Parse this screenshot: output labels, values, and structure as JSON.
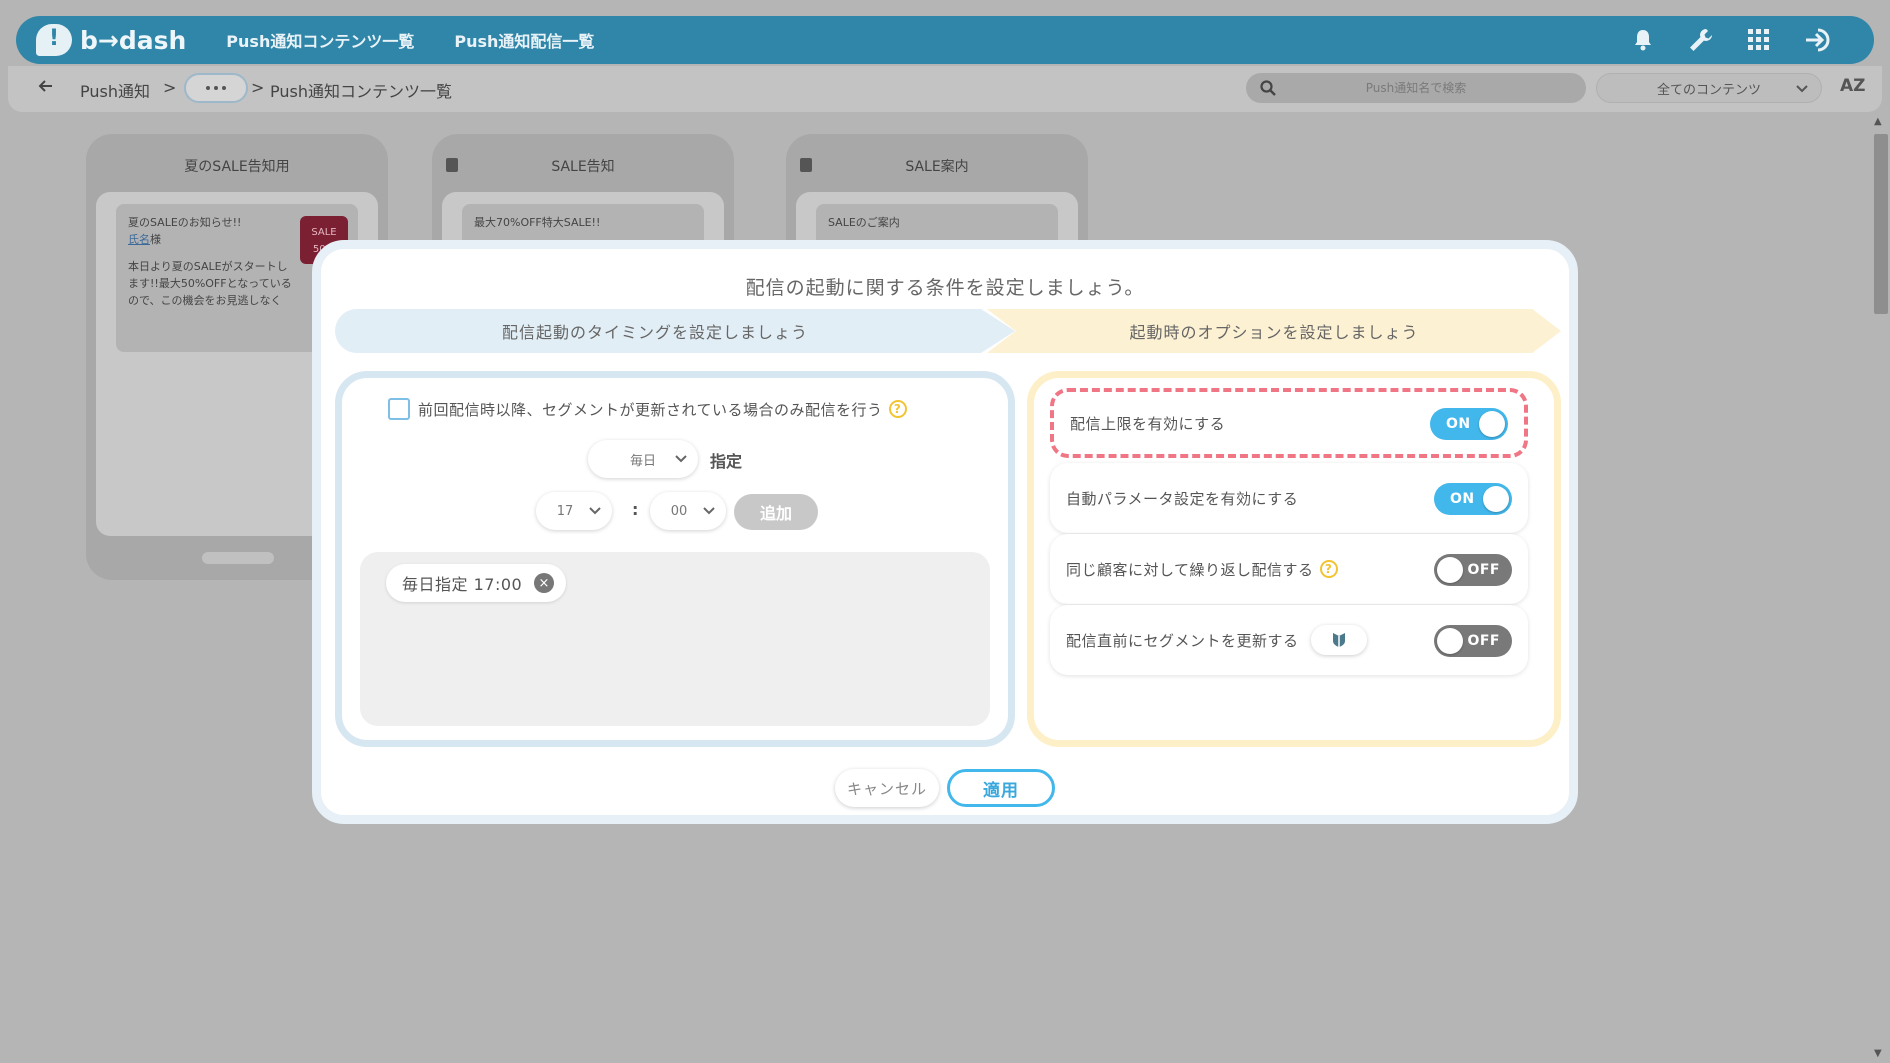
{
  "header": {
    "logo_text": "b→dash",
    "nav": [
      "Push通知コンテンツ一覧",
      "Push通知配信一覧"
    ],
    "icons": [
      "bell-icon",
      "wrench-icon",
      "grid-icon",
      "logout-icon"
    ]
  },
  "breadcrumb": {
    "root": "Push通知",
    "sep1": ">",
    "sep2": ">",
    "current": "Push通知コンテンツ一覧"
  },
  "search": {
    "placeholder": "Push通知名で検索"
  },
  "filter": {
    "selected": "全てのコンテンツ"
  },
  "sort": {
    "label": "AZ"
  },
  "cards": [
    {
      "title": "夏のSALE告知用",
      "msg_title": "夏のSALEのお知らせ!!",
      "name_link": "氏名",
      "name_suffix": "様",
      "body": "本日より夏のSALEがスタートします!!最大50%OFFとなっているので、この機会をお見逃しなく",
      "thumb": "SALE 50%"
    },
    {
      "title": "SALE告知",
      "msg_title": "最大70%OFF特大SALE!!"
    },
    {
      "title": "SALE案内",
      "msg_title": "SALEのご案内"
    }
  ],
  "modal": {
    "title": "配信の起動に関する条件を設定しましょう。",
    "step1": "配信起動のタイミングを設定しましょう",
    "step2": "起動時のオプションを設定しましょう",
    "left": {
      "checkbox_label": "前回配信時以降、セグメントが更新されている場合のみ配信を行う",
      "help": "?",
      "frequency": "毎日",
      "shitei": "指定",
      "hour": "17",
      "colon": ":",
      "minute": "00",
      "add_label": "追加",
      "chip": "毎日指定 17:00",
      "chip_remove": "×"
    },
    "options": [
      {
        "label": "配信上限を有効にする",
        "state": "ON"
      },
      {
        "label": "自動パラメータ設定を有効にする",
        "state": "ON"
      },
      {
        "label": "同じ顧客に対して繰り返し配信する",
        "state": "OFF",
        "help": "?"
      },
      {
        "label": "配信直前にセグメントを更新する",
        "state": "OFF"
      }
    ],
    "cancel_label": "キャンセル",
    "apply_label": "適用"
  },
  "colors": {
    "header": "#2f86a8",
    "toggle_on": "#42b7eb",
    "toggle_off": "#797979",
    "highlight": "#f07585"
  }
}
